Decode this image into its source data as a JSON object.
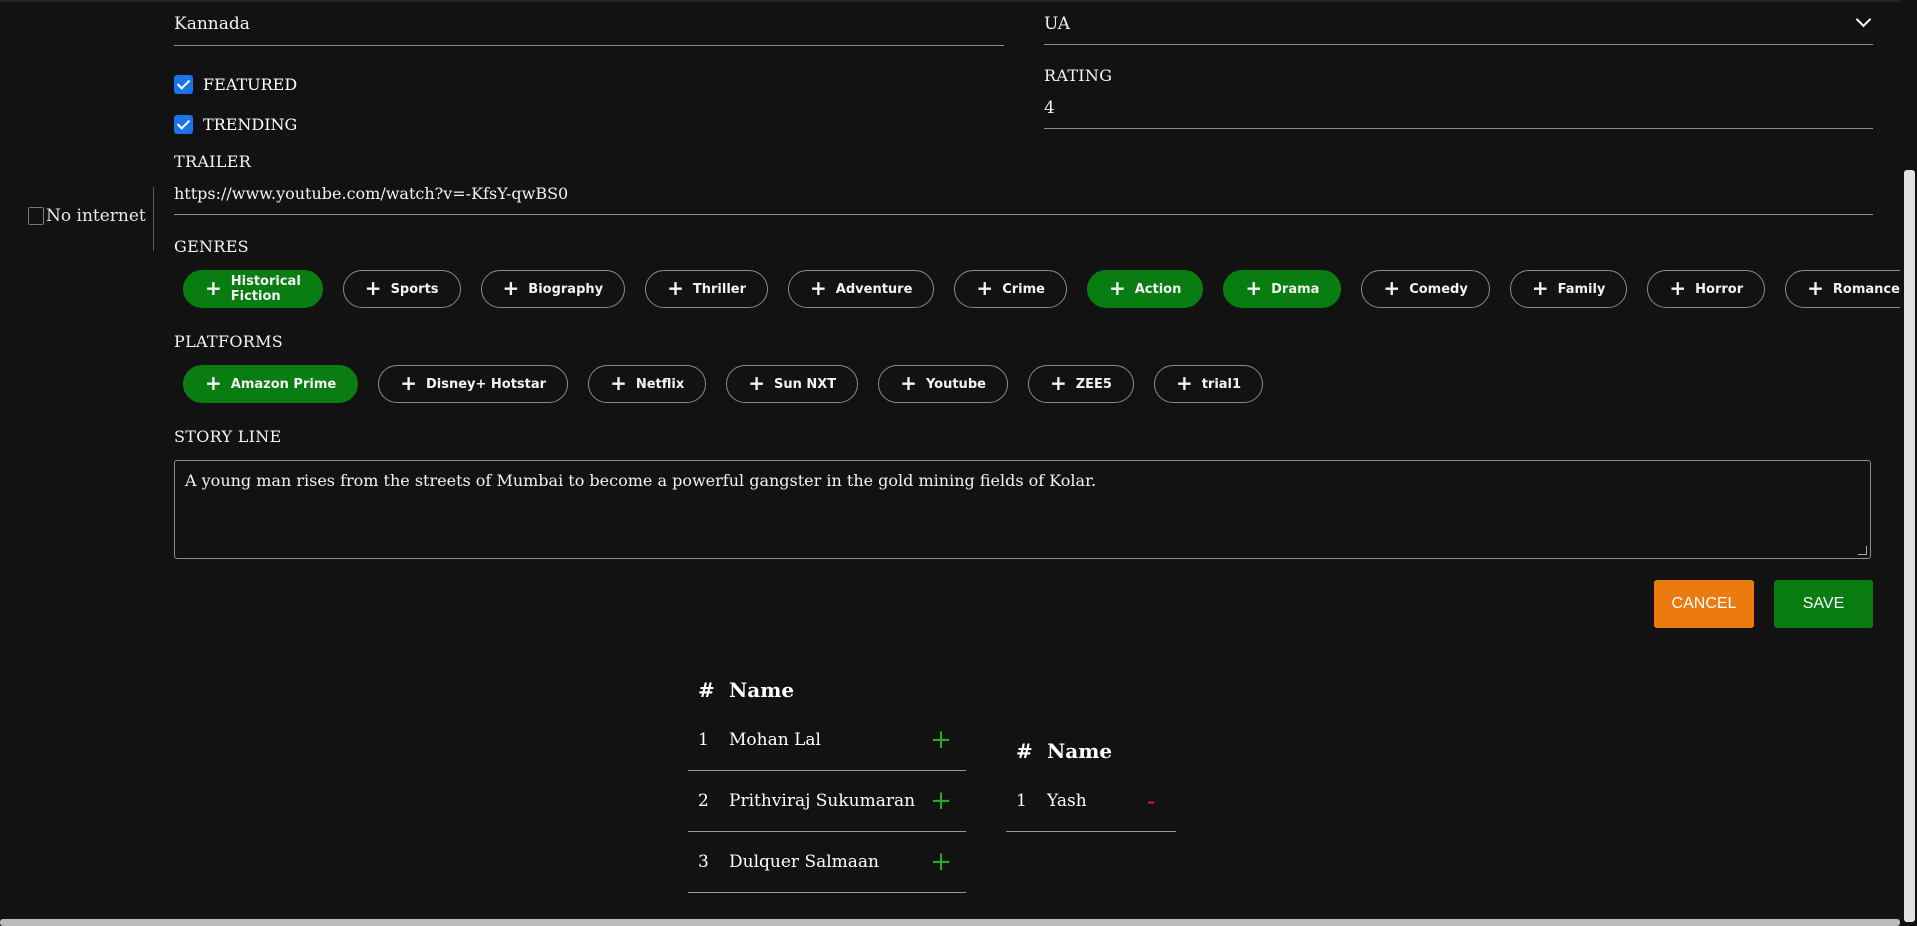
{
  "language": {
    "value": "Kannada"
  },
  "certificate": {
    "value": "UA"
  },
  "featured": {
    "label": "FEATURED",
    "checked": true
  },
  "trending": {
    "label": "TRENDING",
    "checked": true
  },
  "rating": {
    "label": "RATING",
    "value": "4"
  },
  "trailer": {
    "label": "TRAILER",
    "value": "https://www.youtube.com/watch?v=-KfsY-qwBS0"
  },
  "poster": {
    "alt": "No internet"
  },
  "genres": {
    "label": "GENRES",
    "items": [
      {
        "label": "Historical Fiction",
        "selected": true
      },
      {
        "label": "Sports",
        "selected": false
      },
      {
        "label": "Biography",
        "selected": false
      },
      {
        "label": "Thriller",
        "selected": false
      },
      {
        "label": "Adventure",
        "selected": false
      },
      {
        "label": "Crime",
        "selected": false
      },
      {
        "label": "Action",
        "selected": true
      },
      {
        "label": "Drama",
        "selected": true
      },
      {
        "label": "Comedy",
        "selected": false
      },
      {
        "label": "Family",
        "selected": false
      },
      {
        "label": "Horror",
        "selected": false
      },
      {
        "label": "Romance",
        "selected": false
      }
    ]
  },
  "platforms": {
    "label": "PLATFORMS",
    "items": [
      {
        "label": "Amazon Prime",
        "selected": true
      },
      {
        "label": "Disney+ Hotstar",
        "selected": false
      },
      {
        "label": "Netflix",
        "selected": false
      },
      {
        "label": "Sun NXT",
        "selected": false
      },
      {
        "label": "Youtube",
        "selected": false
      },
      {
        "label": "ZEE5",
        "selected": false
      },
      {
        "label": "trial1",
        "selected": false
      }
    ]
  },
  "storyline": {
    "label": "STORY LINE",
    "value": "A young man rises from the streets of Mumbai to become a powerful gangster in the gold mining fields of Kolar."
  },
  "actions": {
    "cancel": "CANCEL",
    "save": "SAVE"
  },
  "available_cast": {
    "header_num": "#",
    "header_name": "Name",
    "rows": [
      {
        "num": "1",
        "name": "Mohan Lal",
        "action": "+"
      },
      {
        "num": "2",
        "name": "Prithviraj Sukumaran",
        "action": "+"
      },
      {
        "num": "3",
        "name": "Dulquer Salmaan",
        "action": "+"
      }
    ]
  },
  "selected_cast": {
    "header_num": "#",
    "header_name": "Name",
    "rows": [
      {
        "num": "1",
        "name": "Yash",
        "action": "-"
      }
    ]
  },
  "colors": {
    "accent_green": "#0a7d12",
    "cancel_orange": "#ec7b0f",
    "background": "#121212"
  }
}
